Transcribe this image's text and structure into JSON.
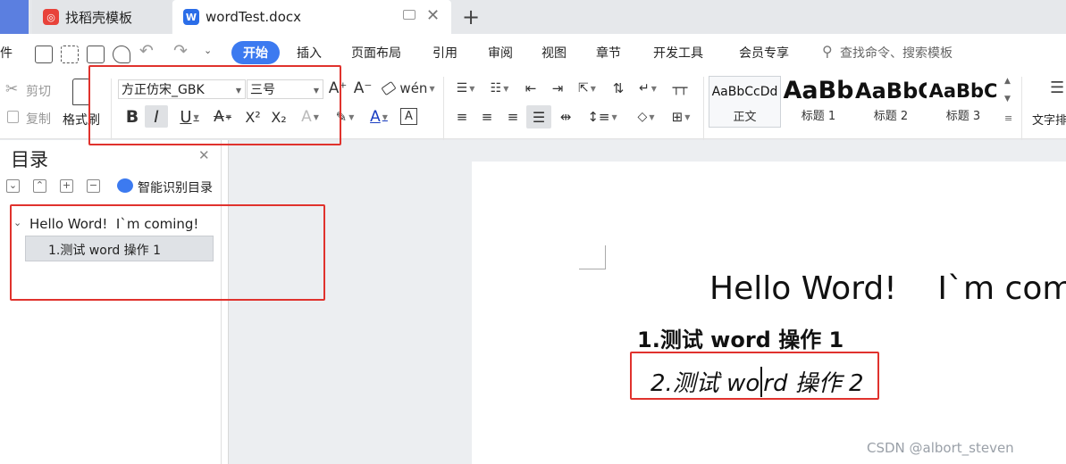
{
  "tabs": [
    {
      "label": "找稻壳模板",
      "icon": "daoke-logo-icon",
      "color": "#e8423a"
    },
    {
      "label": "wordTest.docx",
      "icon": "wps-writer-icon",
      "color": "#2b6de8"
    }
  ],
  "ribbon_menu": {
    "file_label": "件",
    "items": [
      "开始",
      "插入",
      "页面布局",
      "引用",
      "审阅",
      "视图",
      "章节",
      "开发工具",
      "会员专享"
    ],
    "search_placeholder": "查找命令、搜索模板"
  },
  "clipboard": {
    "cut": "剪切",
    "copy": "复制",
    "format_painter": "格式刷"
  },
  "font": {
    "family": "方正仿宋_GBK",
    "size": "三号"
  },
  "styles": [
    {
      "preview": "AaBbCcDd",
      "name": "正文"
    },
    {
      "preview": "AaBb",
      "name": "标题 1"
    },
    {
      "preview": "AaBbC",
      "name": "标题 2"
    },
    {
      "preview": "AaBbC",
      "name": "标题 3"
    }
  ],
  "text_tools_label": "文字排",
  "sidebar": {
    "title": "目录",
    "smart_label": "智能识别目录",
    "outline": [
      {
        "label": "Hello Word!  I`m coming!"
      },
      {
        "label": "1.测试 word 操作 1"
      }
    ]
  },
  "document": {
    "title": "Hello Word!    I`m comi",
    "heading1": "1.测试 word 操作 1",
    "heading2_before_cursor": "2.测试 wo",
    "heading2_after_cursor": "rd 操作 2"
  },
  "watermark": "CSDN @albort_steven",
  "colors": {
    "accent": "#3c7af0",
    "highlight_box": "#e0322d"
  }
}
